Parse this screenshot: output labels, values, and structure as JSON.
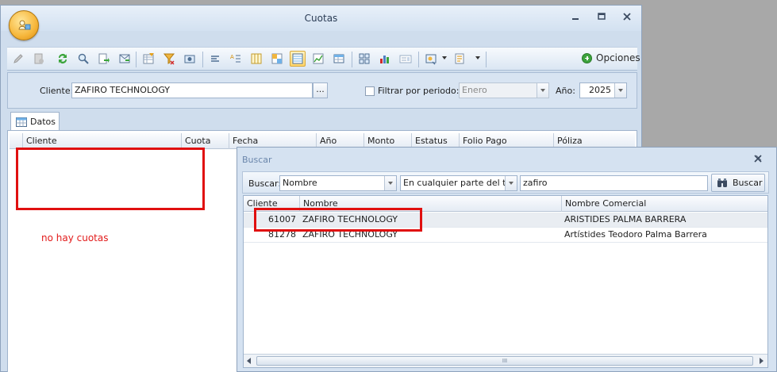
{
  "window": {
    "title": "Cuotas"
  },
  "toolbar": {
    "opciones_label": "Opciones"
  },
  "filter": {
    "cliente_label": "Cliente:",
    "cliente_value": "ZAFIRO TECHNOLOGY",
    "cliente_button": "...",
    "periodo_label": "Filtrar por periodo:",
    "periodo_checked": false,
    "mes_value": "Enero",
    "anio_label": "Año:",
    "anio_value": "2025"
  },
  "tabs": {
    "datos_label": "Datos"
  },
  "main_grid": {
    "columns": [
      "Cliente",
      "Cuota",
      "Fecha",
      "Año",
      "Monto",
      "Estatus",
      "Folio Pago Anticipado",
      "Póliza"
    ],
    "rows": [],
    "empty_message": "no hay cuotas"
  },
  "search_dialog": {
    "title": "Buscar",
    "buscar_label": "Buscar:",
    "campo_value": "Nombre",
    "modo_value": "En cualquier parte del t...",
    "texto_value": "zafiro",
    "buscar_button": "Buscar",
    "columns": [
      "Cliente",
      "Nombre",
      "Nombre Comercial"
    ],
    "rows": [
      {
        "cliente": "61007",
        "nombre": "ZAFIRO TECHNOLOGY",
        "nombre_comercial": "ARISTIDES PALMA BARRERA"
      },
      {
        "cliente": "81278",
        "nombre": "ZAFIRO TECHNOLOGY",
        "nombre_comercial": "Artístides Teodoro Palma Barrera"
      }
    ],
    "scroll_grip": "III"
  },
  "colors": {
    "annotation_red": "#e01010",
    "empty_message": "#e21b1b",
    "active_toolbar": "#ffd56a"
  }
}
